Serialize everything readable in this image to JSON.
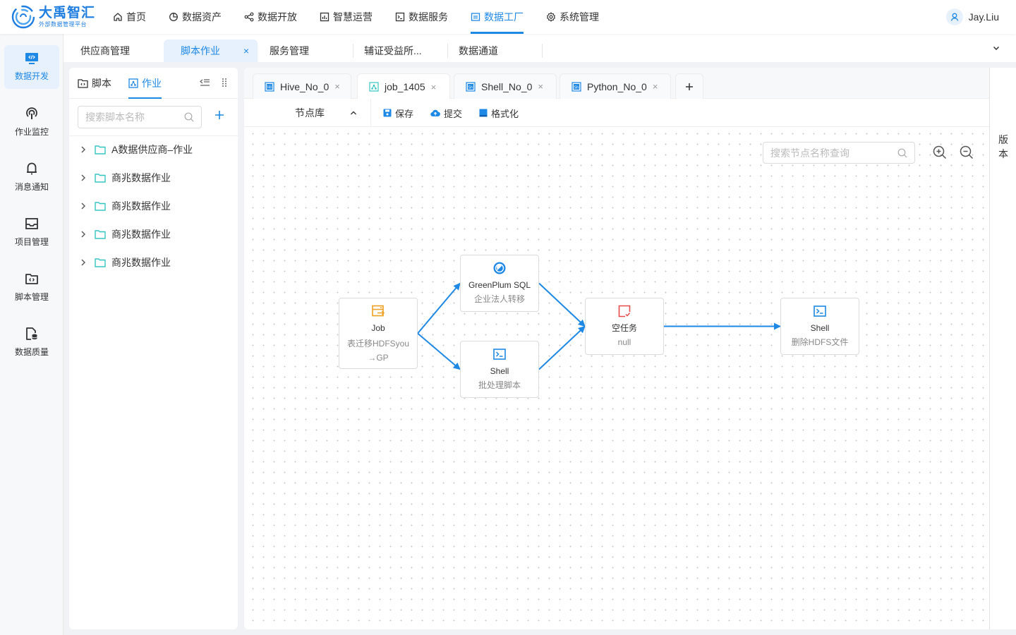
{
  "brand": {
    "title": "大禹智汇",
    "subtitle": "外部数据管理平台",
    "color": "#1e7de0"
  },
  "nav": {
    "items": [
      {
        "label": "首页",
        "icon": "home-icon"
      },
      {
        "label": "数据资产",
        "icon": "pie-chart-icon"
      },
      {
        "label": "数据开放",
        "icon": "share-icon"
      },
      {
        "label": "智慧运营",
        "icon": "bar-chart-icon"
      },
      {
        "label": "数据服务",
        "icon": "terminal-icon"
      },
      {
        "label": "数据工厂",
        "icon": "factory-icon",
        "active": true
      },
      {
        "label": "系统管理",
        "icon": "gear-icon"
      }
    ]
  },
  "user": {
    "name": "Jay.Liu"
  },
  "rail": {
    "items": [
      {
        "label": "数据开发",
        "icon": "code-monitor-icon",
        "active": true
      },
      {
        "label": "作业监控",
        "icon": "broadcast-icon"
      },
      {
        "label": "消息通知",
        "icon": "bell-icon"
      },
      {
        "label": "项目管理",
        "icon": "inbox-icon"
      },
      {
        "label": "脚本管理",
        "icon": "code-folder-icon"
      },
      {
        "label": "数据质量",
        "icon": "file-database-icon"
      }
    ]
  },
  "page_tabs": {
    "items": [
      {
        "label": "供应商管理"
      },
      {
        "label": "脚本作业",
        "active": true,
        "close": "×"
      },
      {
        "label": "服务管理"
      },
      {
        "label": "辅证受益所..."
      },
      {
        "label": "数据通道"
      }
    ]
  },
  "tree": {
    "tabs": [
      {
        "label": "脚本",
        "icon": "script-folder-icon"
      },
      {
        "label": "作业",
        "icon": "workflow-icon",
        "active": true
      }
    ],
    "search_placeholder": "搜索脚本名称",
    "search_value": "",
    "items": [
      {
        "label": "A数据供应商–作业"
      },
      {
        "label": "商兆数据作业"
      },
      {
        "label": "商兆数据作业"
      },
      {
        "label": "商兆数据作业"
      },
      {
        "label": "商兆数据作业"
      }
    ]
  },
  "editor": {
    "tabs": [
      {
        "label": "Hive_No_0",
        "icon": "hive-file-icon",
        "close": "×"
      },
      {
        "label": "job_1405",
        "icon": "workflow-icon",
        "close": "×",
        "active": true
      },
      {
        "label": "Shell_No_0",
        "icon": "shell-file-icon",
        "close": "×"
      },
      {
        "label": "Python_No_0",
        "icon": "python-file-icon",
        "close": "×"
      }
    ],
    "add_tab": "+",
    "toolbar": {
      "node_library": "节点库",
      "save": "保存",
      "submit": "提交",
      "format": "格式化"
    },
    "canvas": {
      "search_placeholder": "搜索节点名称查询",
      "search_value": "",
      "nodes": [
        {
          "id": "job",
          "title": "Job",
          "subtitle": "表迁移HDFSyou→GP",
          "icon": "job-icon",
          "icon_color": "#f0a020"
        },
        {
          "id": "gp",
          "title": "GreenPlum SQL",
          "subtitle": "企业法人转移",
          "icon": "greenplum-icon",
          "icon_color": "#1e88e5"
        },
        {
          "id": "shell1",
          "title": "Shell",
          "subtitle": "批处理脚本",
          "icon": "shell-icon",
          "icon_color": "#1e88e5"
        },
        {
          "id": "empty",
          "title": "空任务",
          "subtitle": "null",
          "icon": "empty-task-icon",
          "icon_color": "#e84a4a"
        },
        {
          "id": "shell2",
          "title": "Shell",
          "subtitle": "删除HDFS文件",
          "icon": "shell-icon",
          "icon_color": "#1e88e5"
        }
      ],
      "edges": [
        {
          "from": "job",
          "to": "gp"
        },
        {
          "from": "job",
          "to": "shell1"
        },
        {
          "from": "gp",
          "to": "empty"
        },
        {
          "from": "shell1",
          "to": "empty"
        },
        {
          "from": "empty",
          "to": "shell2"
        }
      ],
      "edge_color": "#1e88e5"
    }
  },
  "version_panel": {
    "label": "版本"
  }
}
